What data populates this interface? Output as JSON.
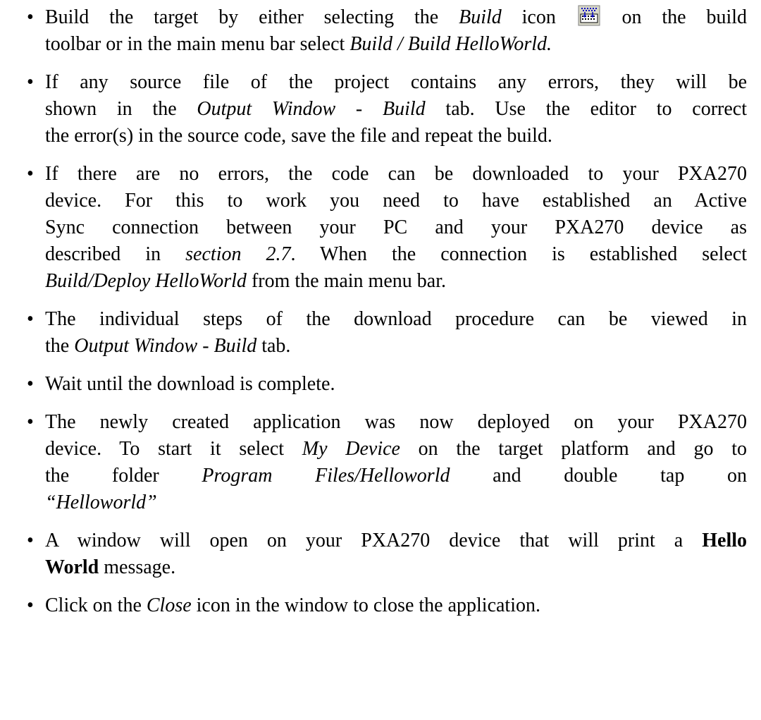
{
  "items": [
    {
      "lines": [
        {
          "pre": "Build the target by either selecting the ",
          "em": "Build",
          "post_icon": " icon ",
          "post": " on the build"
        },
        {
          "text": "toolbar or in the main menu bar select ",
          "em": "Build / Build HelloWorld."
        }
      ]
    },
    {
      "p1": "If any source file of the project contains any errors, they will be",
      "p2a": "shown in the ",
      "p2em": "Output Window - Build",
      "p2b": " tab. Use the editor to correct",
      "p3": "the error(s) in the source code, save the file and repeat the build."
    },
    {
      "p1": "If there are no errors, the code can be downloaded to your PXA270",
      "p2": "device. For this to work you need to have established an Active",
      "p3": "Sync connection between your PC and your PXA270 device as",
      "p4a": "described in ",
      "p4em": "section 2.7",
      "p4b": ". When the connection is established select",
      "p5em": "Build/Deploy HelloWorld",
      "p5b": " from the main menu bar."
    },
    {
      "p1": "The individual steps of the download procedure can be viewed in",
      "p2a": "the ",
      "p2em": "Output Window - Build",
      "p2b": " tab."
    },
    {
      "p1": "Wait until the download is complete."
    },
    {
      "p1": "The newly created application was now deployed on your PXA270",
      "p2a": "device. To start it select ",
      "p2em": "My Device",
      "p2b": " on the target platform and go to",
      "p3a": "the folder ",
      "p3em": "Program Files/Helloworld",
      "p3b": " and double tap on",
      "p4em": "“Helloworld”"
    },
    {
      "p1a": "A window will open on your PXA270 device that will print a ",
      "p1b": "Hello",
      "p2b": "World",
      "p2c": " message."
    },
    {
      "p1a": "Click on the ",
      "p1em": "Close",
      "p1b": " icon in the window to close the application."
    }
  ],
  "bullet_char": "•",
  "icons": {
    "build": "build-icon"
  }
}
